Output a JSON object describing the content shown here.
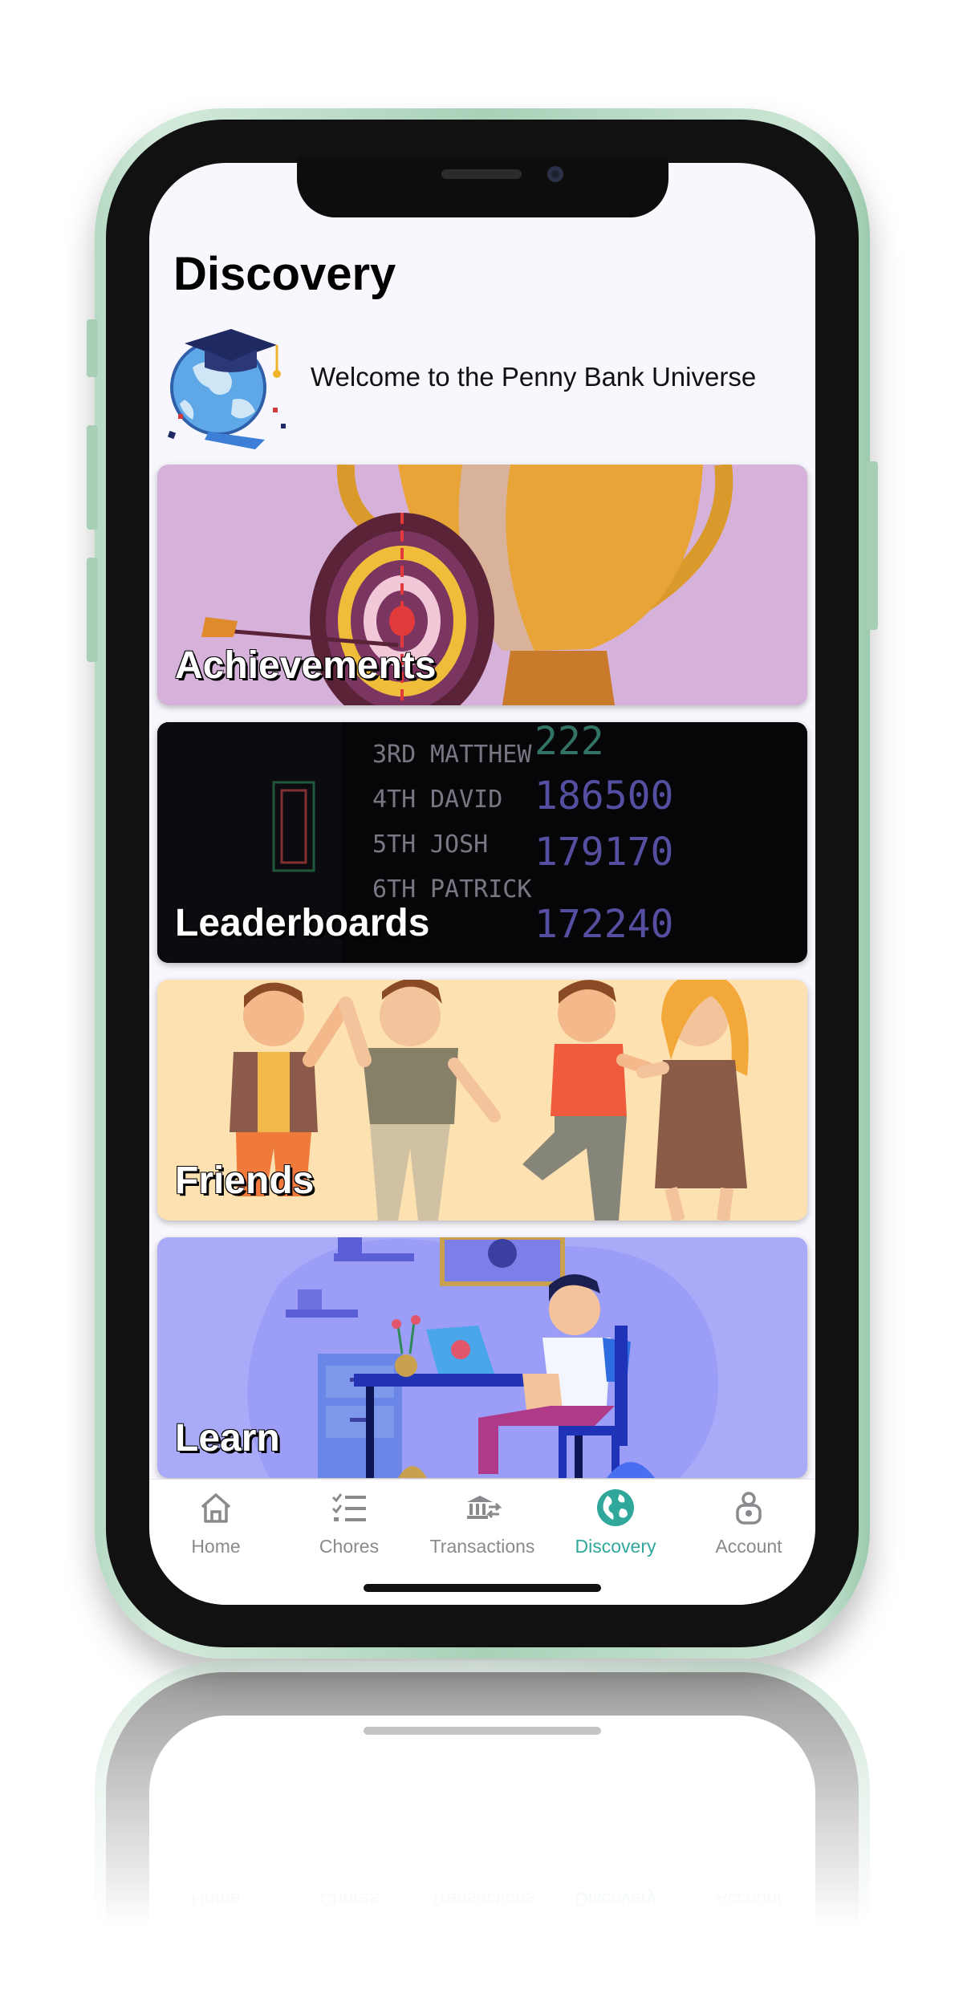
{
  "screen": {
    "title": "Discovery",
    "welcome_text": "Welcome to the Penny Bank Universe"
  },
  "cards": [
    {
      "label": "Achievements",
      "icon": "trophy-target-illustration",
      "color": "#d6b2db"
    },
    {
      "label": "Leaderboards",
      "icon": "scoreboard-illustration",
      "color": "#060608",
      "board": [
        {
          "rank": "3RD",
          "name": "MATTHEW"
        },
        {
          "rank": "4TH",
          "name": "DAVID",
          "score": "186500"
        },
        {
          "rank": "5TH",
          "name": "JOSH",
          "score": "179170"
        },
        {
          "rank": "6TH",
          "name": "PATRICK",
          "score": "172240"
        }
      ]
    },
    {
      "label": "Friends",
      "icon": "friends-high-five-illustration",
      "color": "#fde1b0"
    },
    {
      "label": "Learn",
      "icon": "student-laptop-illustration",
      "color": "#a9aaf8"
    }
  ],
  "tabs": [
    {
      "label": "Home",
      "icon": "home-icon",
      "active": false
    },
    {
      "label": "Chores",
      "icon": "checklist-icon",
      "active": false
    },
    {
      "label": "Transactions",
      "icon": "transfer-icon",
      "active": false
    },
    {
      "label": "Discovery",
      "icon": "globe-icon",
      "active": true
    },
    {
      "label": "Account",
      "icon": "user-icon",
      "active": false
    }
  ],
  "colors": {
    "accent": "#2fa79b",
    "inactive": "#8a8a8e",
    "frame": "#b6d9c3"
  }
}
